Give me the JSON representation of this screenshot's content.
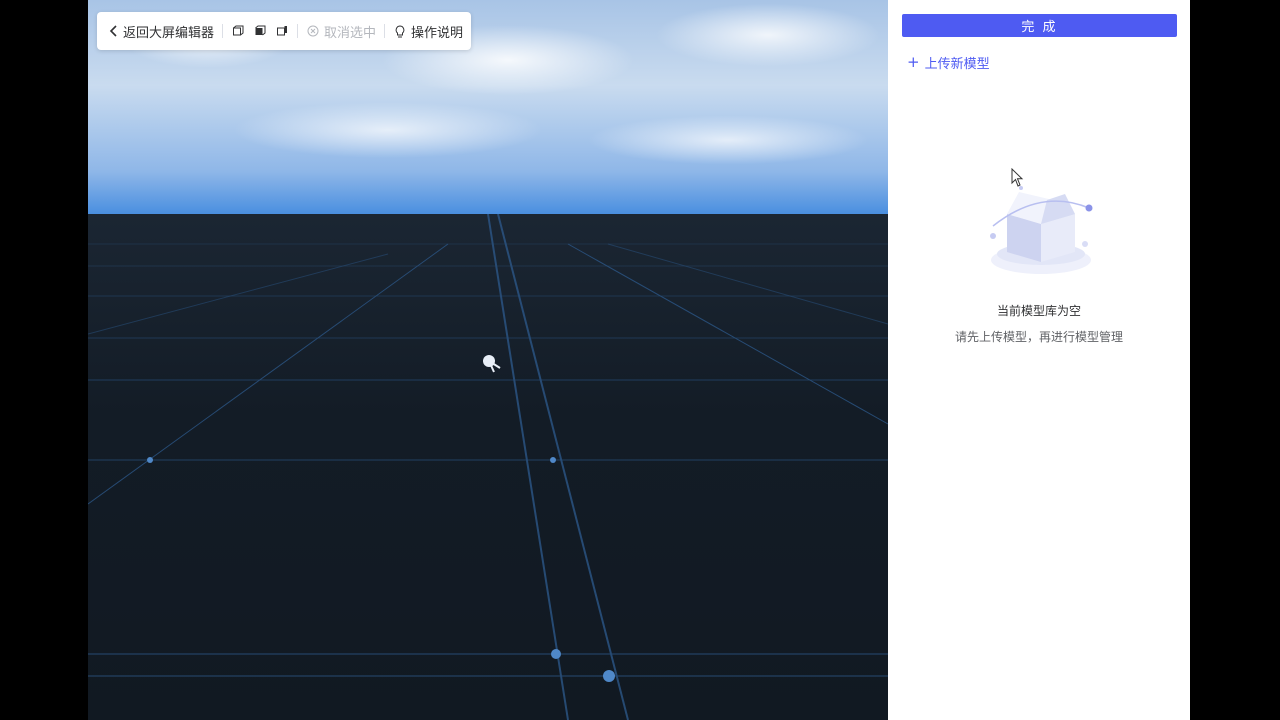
{
  "toolbar": {
    "back_label": "返回大屏编辑器",
    "deselect_label": "取消选中",
    "help_label": "操作说明"
  },
  "panel": {
    "done_label": "完 成",
    "upload_label": "上传新模型",
    "empty_title": "当前模型库为空",
    "empty_desc": "请先上传模型，再进行模型管理"
  },
  "colors": {
    "accent": "#4e5bf2",
    "ground": "#131c26",
    "grid_line": "#2e5a8a"
  }
}
